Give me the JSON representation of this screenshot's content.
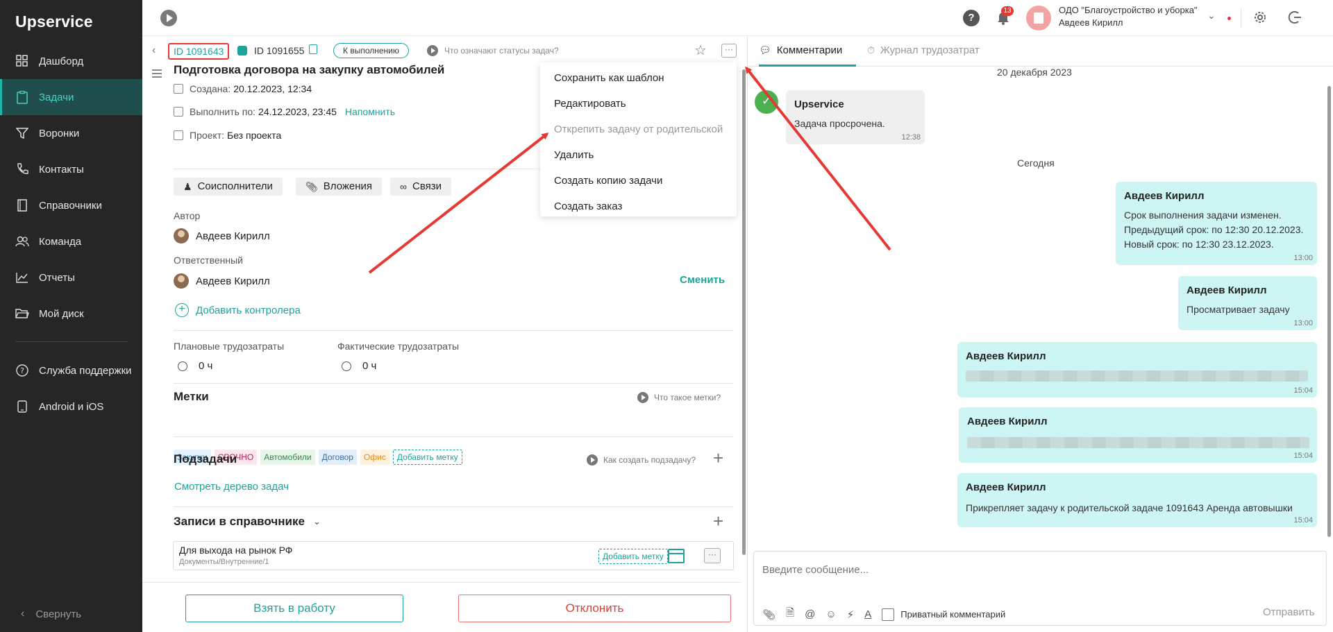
{
  "app": {
    "logo": "Upservice"
  },
  "sidebar": {
    "items": [
      {
        "label": "Дашборд",
        "icon": "dashboard-icon"
      },
      {
        "label": "Задачи",
        "icon": "tasks-icon",
        "active": true
      },
      {
        "label": "Воронки",
        "icon": "funnel-icon"
      },
      {
        "label": "Контакты",
        "icon": "phone-icon"
      },
      {
        "label": "Справочники",
        "icon": "book-icon"
      },
      {
        "label": "Команда",
        "icon": "team-icon"
      },
      {
        "label": "Отчеты",
        "icon": "chart-icon"
      },
      {
        "label": "Мой диск",
        "icon": "folder-icon"
      }
    ],
    "items2": [
      {
        "label": "Служба поддержки",
        "icon": "help-icon"
      },
      {
        "label": "Android и iOS",
        "icon": "mobile-icon"
      }
    ],
    "collapse": "Свернуть"
  },
  "topbar": {
    "notifications": "13",
    "org_name": "ОДО \"Благоустройство и уборка\"",
    "user": "Авдеев Кирилл"
  },
  "task": {
    "id": "ID 1091643",
    "parent_id": "ID 1091655",
    "status": "К выполнению",
    "status_help": "Что означают статусы задач?",
    "title": "Подготовка договора на закупку автомобилей",
    "created_label": "Создана:",
    "created": "20.12.2023, 12:34",
    "due_label": "Выполнить по:",
    "due": "24.12.2023, 23:45",
    "remind": "Напомнить",
    "project_label": "Проект:",
    "project": "Без проекта",
    "chips": {
      "coexec": "Соисполнители",
      "attach": "Вложения",
      "links": "Связи"
    },
    "author_label": "Автор",
    "author": "Авдеев Кирилл",
    "responsible_label": "Ответственный",
    "responsible": "Авдеев Кирилл",
    "change": "Сменить",
    "add_controller": "Добавить контролера",
    "planned_label": "Плановые трудозатраты",
    "planned": "0 ч",
    "actual_label": "Фактические трудозатраты",
    "actual": "0 ч",
    "tags_title": "Метки",
    "tags_help": "Что такое метки?",
    "tags": [
      {
        "label": "Закупки",
        "bg": "#e3f2fd",
        "fg": "#2a7fb8"
      },
      {
        "label": "СРОЧНО",
        "bg": "#fde7ef",
        "fg": "#c2185b"
      },
      {
        "label": "Автомобили",
        "bg": "#e8f5e9",
        "fg": "#2e8b4e"
      },
      {
        "label": "Договор",
        "bg": "#e3eef9",
        "fg": "#3a6ea5"
      },
      {
        "label": "Офис",
        "bg": "#fff3e0",
        "fg": "#e08a1e"
      }
    ],
    "add_tag": "Добавить метку",
    "subtasks_title": "Подзадачи",
    "subtasks_help": "Как создать подзадачу?",
    "tree_link": "Смотреть дерево задач",
    "dir_title": "Записи в справочнике",
    "dir_name": "Для выхода на рынок РФ",
    "dir_path": "Документы/Внутренние/1",
    "dir_add_tag": "Добавить метку",
    "btn_take": "Взять в работу",
    "btn_reject": "Отклонить"
  },
  "dropdown": {
    "items": [
      {
        "label": "Сохранить как шаблон",
        "disabled": false
      },
      {
        "label": "Редактировать",
        "disabled": false
      },
      {
        "label": "Открепить задачу от родительской",
        "disabled": true
      },
      {
        "label": "Удалить",
        "disabled": false
      },
      {
        "label": "Создать копию задачи",
        "disabled": false
      },
      {
        "label": "Создать заказ",
        "disabled": false
      }
    ]
  },
  "comments": {
    "tab_comments": "Комментарии",
    "tab_log": "Журнал трудозатрат",
    "date1": "20 декабря 2023",
    "date2": "Сегодня",
    "m1": {
      "author": "Upservice",
      "text": "Задача просрочена.",
      "time": "12:38"
    },
    "m2": {
      "author": "Авдеев Кирилл",
      "line1": "Срок выполнения задачи изменен.",
      "line2": "Предыдущий срок: по 12:30 20.12.2023.",
      "line3": "Новый срок: по 12:30 23.12.2023.",
      "time": "13:00"
    },
    "m3": {
      "author": "Авдеев Кирилл",
      "text": "Просматривает задачу",
      "time": "13:00"
    },
    "m4": {
      "author": "Авдеев Кирилл",
      "time": "15:04"
    },
    "m5": {
      "author": "Авдеев Кирилл",
      "time": "15:04"
    },
    "m6": {
      "author": "Авдеев Кирилл",
      "text": "Прикрепляет задачу к родительской задаче 1091643 Аренда автовышки",
      "time": "15:04"
    },
    "input_placeholder": "Введите сообщение...",
    "private": "Приватный комментарий",
    "send": "Отправить"
  },
  "colors": {
    "accent": "#1ba39c",
    "annotation": "#e53935"
  }
}
